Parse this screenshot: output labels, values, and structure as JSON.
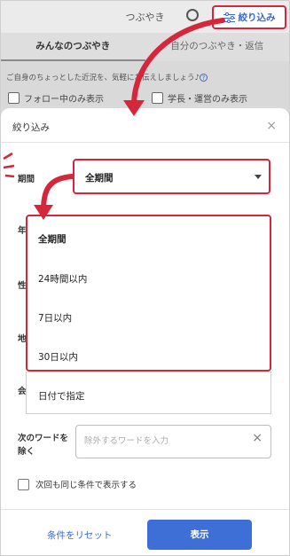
{
  "app": {
    "title": "つぶやき",
    "filter_button": "絞り込み",
    "tabs": [
      "みんなのつぶやき",
      "自分のつぶやき・返信"
    ],
    "hint": "ご自身のちょっとした近況を、気軽にお伝えしましょう♪",
    "hint_icon": "?",
    "checks": [
      "フォロー中のみ表示",
      "学長・運営のみ表示"
    ]
  },
  "modal": {
    "title": "絞り込み",
    "close": "×",
    "period_label": "期間",
    "period_value": "全期間",
    "hidden_labels": [
      "年",
      "性",
      "地",
      "会"
    ],
    "options": [
      "全期間",
      "24時間以内",
      "7日以内",
      "30日以内",
      "日付で指定"
    ],
    "exclude_label_1": "次のワードを",
    "exclude_label_2": "除く",
    "exclude_placeholder": "除外するワードを入力",
    "exclude_clear": "×",
    "remember_label": "次回も同じ条件で表示する",
    "reset_label": "条件をリセット",
    "show_label": "表示"
  },
  "colors": {
    "accent_red": "#d6263b",
    "primary_blue": "#3e6fd7"
  },
  "icons": {
    "filter": "filter-icon",
    "search": "search-icon",
    "close": "close-icon",
    "clear": "clear-icon",
    "caret": "caret-down-icon",
    "arrow": "curved-arrow-icon"
  }
}
